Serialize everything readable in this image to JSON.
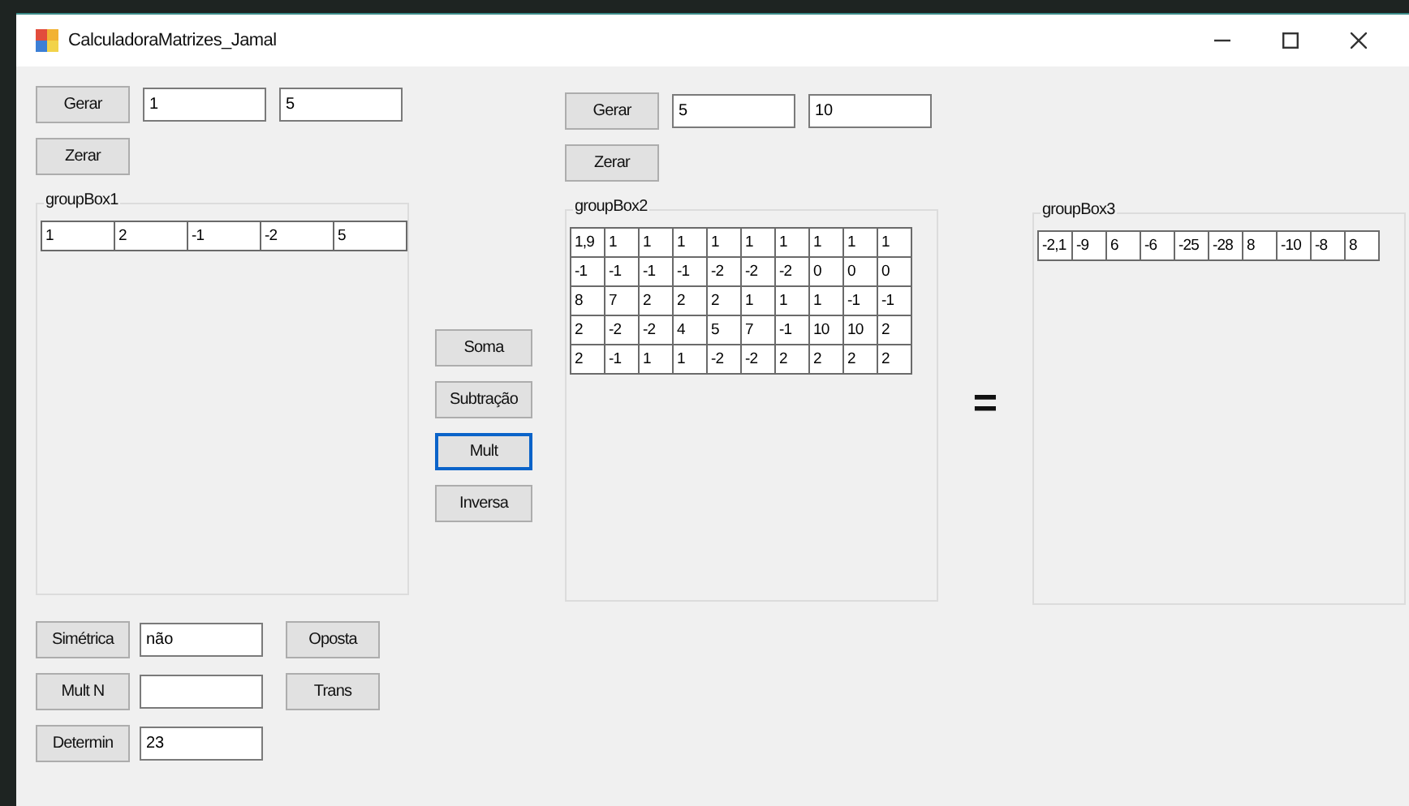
{
  "window": {
    "title": "CalculadoraMatrizes_Jamal"
  },
  "matrix_a": {
    "generate_button": "Gerar",
    "rows": "1",
    "columns": "5",
    "clear_button": "Zerar",
    "group_title": "groupBox1",
    "cells": [
      [
        "1",
        "2",
        "-1",
        "-2",
        "5"
      ]
    ]
  },
  "operations": [
    {
      "label": "Soma",
      "selected": false
    },
    {
      "label": "Subtração",
      "selected": false
    },
    {
      "label": "Mult",
      "selected": true
    },
    {
      "label": "Inversa",
      "selected": false
    }
  ],
  "matrix_b": {
    "generate_button": "Gerar",
    "rows": "5",
    "columns": "10",
    "clear_button": "Zerar",
    "group_title": "groupBox2",
    "cells": [
      [
        "1,9",
        "1",
        "1",
        "1",
        "1",
        "1",
        "1",
        "1",
        "1",
        "1"
      ],
      [
        "-1",
        "-1",
        "-1",
        "-1",
        "-2",
        "-2",
        "-2",
        "0",
        "0",
        "0"
      ],
      [
        "8",
        "7",
        "2",
        "2",
        "2",
        "1",
        "1",
        "1",
        "-1",
        "-1"
      ],
      [
        "2",
        "-2",
        "-2",
        "4",
        "5",
        "7",
        "-1",
        "10",
        "10",
        "2"
      ],
      [
        "2",
        "-1",
        "1",
        "1",
        "-2",
        "-2",
        "2",
        "2",
        "2",
        "2"
      ]
    ]
  },
  "equals": "=",
  "result": {
    "group_title": "groupBox3",
    "cells": [
      [
        "-2,1",
        "-9",
        "6",
        "-6",
        "-25",
        "-28",
        "8",
        "-10",
        "-8",
        "8"
      ]
    ]
  },
  "tools": [
    {
      "button": "Simétrica",
      "value": "não"
    },
    {
      "button": "Mult N"
    },
    {
      "button": "Determin",
      "value": "23"
    }
  ],
  "side_buttons": [
    "Oposta",
    "Trans"
  ]
}
